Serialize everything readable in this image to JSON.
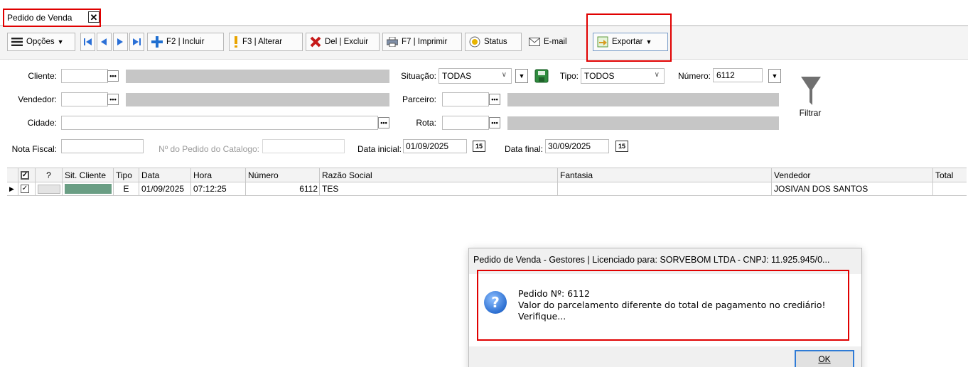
{
  "tab": {
    "title": "Pedido de Venda",
    "close": "✕"
  },
  "toolbar": {
    "options": "Opções",
    "include": "F2 | Incluir",
    "alter": "F3 | Alterar",
    "delete": "Del | Excluir",
    "print": "F7 | Imprimir",
    "status": "Status",
    "email": "E-mail",
    "export": "Exportar"
  },
  "filters": {
    "cliente_label": "Cliente:",
    "vendedor_label": "Vendedor:",
    "cidade_label": "Cidade:",
    "nota_fiscal_label": "Nota Fiscal:",
    "pedido_catalogo_label": "Nº do Pedido do Catalogo:",
    "situacao_label": "Situação:",
    "situacao_value": "TODAS",
    "tipo_label": "Tipo:",
    "tipo_value": "TODOS",
    "numero_label": "Número:",
    "numero_value": "6112",
    "parceiro_label": "Parceiro:",
    "rota_label": "Rota:",
    "data_inicial_label": "Data inicial:",
    "data_inicial_value": "01/09/2025",
    "data_final_label": "Data final:",
    "data_final_value": "30/09/2025",
    "filtrar_label": "Filtrar",
    "calendar_glyph": "15"
  },
  "grid": {
    "columns": [
      "?",
      "Sit. Cliente",
      "Tipo",
      "Data",
      "Hora",
      "Número",
      "Razão Social",
      "Fantasia",
      "Vendedor",
      "Total"
    ],
    "row": {
      "tipo": "E",
      "data": "01/09/2025",
      "hora": "07:12:25",
      "numero": "6112",
      "razao_social": "TES",
      "fantasia": "",
      "vendedor": "JOSIVAN DOS SANTOS",
      "total": ""
    },
    "status_color": "#6a9e84"
  },
  "dialog": {
    "title": "Pedido de Venda - Gestores | Licenciado para: SORVEBOM LTDA - CNPJ: 11.925.945/0...",
    "line1": "Pedido Nº: 6112",
    "line2": "Valor do parcelamento diferente do total de pagamento no crediário!",
    "line3": "Verifique...",
    "ok": "OK",
    "icon_glyph": "?"
  },
  "colors": {
    "highlight": "#e00000",
    "accent": "#2f7bd6"
  }
}
